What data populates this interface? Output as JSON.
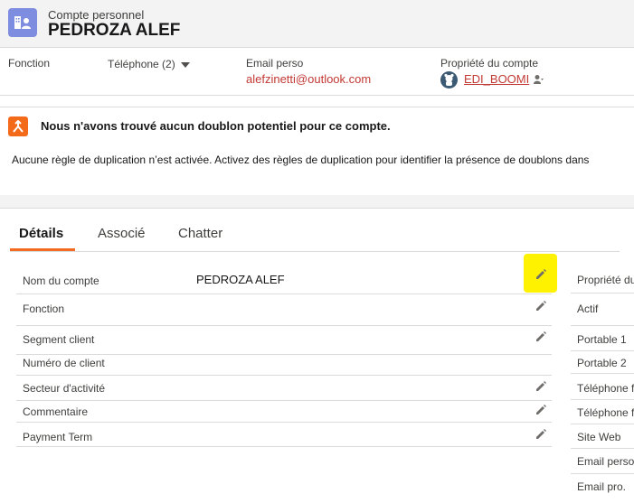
{
  "header": {
    "object_type": "Compte personnel",
    "record_name": "PEDROZA ALEF",
    "icon": "person-account-icon",
    "icon_color": "#7f8de1"
  },
  "highlights": {
    "fonction_label": "Fonction",
    "telephone_label": "Téléphone (2)",
    "email_label": "Email perso",
    "email_value": "alefzinetti@outlook.com",
    "owner_label": "Propriété du compte",
    "owner_value": "EDI_BOOMI"
  },
  "duplicates": {
    "title": "Nous n'avons trouvé aucun doublon potentiel pour ce compte.",
    "body": "Aucune règle de duplication n’est activée. Activez des règles de duplication pour identifier la présence de doublons dans",
    "icon_color": "#f46a1b"
  },
  "tabs": [
    {
      "label": "Détails",
      "active": true
    },
    {
      "label": "Associé",
      "active": false
    },
    {
      "label": "Chatter",
      "active": false
    }
  ],
  "fields_left": [
    {
      "label": "Nom du compte",
      "value": "PEDROZA ALEF",
      "editable": true,
      "highlighted": true
    },
    {
      "label": "Fonction",
      "value": "",
      "editable": true
    },
    {
      "label": "Segment client",
      "value": "",
      "editable": true
    },
    {
      "label": "Numéro de client",
      "value": "",
      "editable": false
    },
    {
      "label": "Secteur d'activité",
      "value": "",
      "editable": true
    },
    {
      "label": "Commentaire",
      "value": "",
      "editable": true
    },
    {
      "label": "Payment Term",
      "value": "",
      "editable": true
    }
  ],
  "fields_right": [
    {
      "label": "Propriété du"
    },
    {
      "label": "Actif"
    },
    {
      "label": "Portable 1"
    },
    {
      "label": "Portable 2"
    },
    {
      "label": "Téléphone f"
    },
    {
      "label": "Téléphone f"
    },
    {
      "label": "Site Web"
    },
    {
      "label": "Email perso"
    },
    {
      "label": "Email pro."
    }
  ],
  "colors": {
    "link": "#c23934",
    "tab_active_underline": "#f26b21",
    "edit_highlight": "#fff200"
  }
}
